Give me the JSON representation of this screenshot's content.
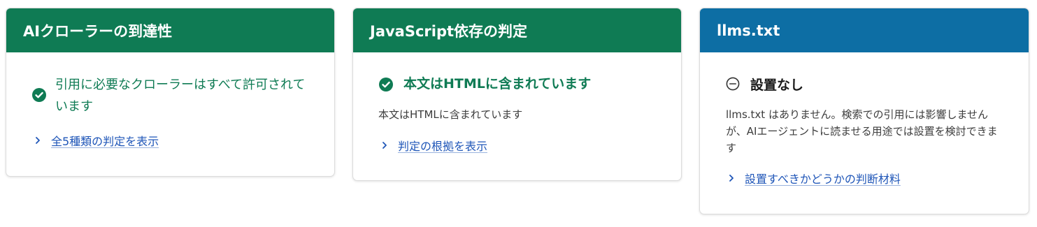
{
  "cards": [
    {
      "title": "AIクローラーの到達性",
      "status_line1": "引用に必要なクローラーはすべて許可されて",
      "status_line2": "います",
      "link": "全5種類の判定を表示",
      "accent": "#0f7b54"
    },
    {
      "title": "JavaScript依存の判定",
      "status": "本文はHTMLに含まれています",
      "description": "本文はHTMLに含まれています",
      "link": "判定の根拠を表示",
      "accent": "#0f7b54"
    },
    {
      "title": "llms.txt",
      "status": "設置なし",
      "description_line1": "llms.txt はありません。検索での引用には影響しません",
      "description_line2": "が、AIエージェントに読ませる用途では設置を検討できま",
      "description_line3": "す",
      "link": "設置すべきかどうかの判断材料",
      "accent": "#0d6ea4"
    }
  ],
  "icons": {
    "success": "check-circle-icon",
    "neutral": "minus-circle-icon",
    "link": "chevron-right-icon"
  },
  "colors": {
    "green": "#0f7b54",
    "blue": "#0d6ea4",
    "link": "#1f56b8"
  }
}
